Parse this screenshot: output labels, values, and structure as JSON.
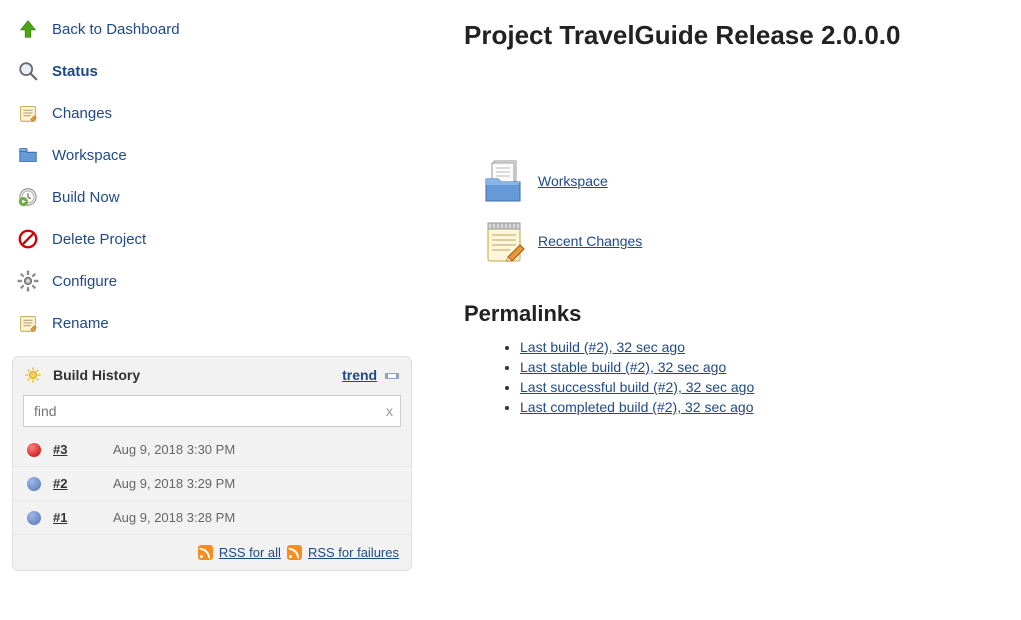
{
  "nav": {
    "back": "Back to Dashboard",
    "status": "Status",
    "changes": "Changes",
    "workspace": "Workspace",
    "build_now": "Build Now",
    "delete_project": "Delete Project",
    "configure": "Configure",
    "rename": "Rename"
  },
  "build_history": {
    "title": "Build History",
    "trend_label": "trend",
    "find_placeholder": "find",
    "builds": [
      {
        "number": "#3",
        "date": "Aug 9, 2018 3:30 PM",
        "status": "red"
      },
      {
        "number": "#2",
        "date": "Aug 9, 2018 3:29 PM",
        "status": "blue"
      },
      {
        "number": "#1",
        "date": "Aug 9, 2018 3:28 PM",
        "status": "blue"
      }
    ],
    "rss_all": "RSS for all",
    "rss_failures": "RSS for failures"
  },
  "main": {
    "title": "Project TravelGuide Release 2.0.0.0",
    "workspace_link": "Workspace",
    "recent_changes_link": "Recent Changes",
    "permalinks_heading": "Permalinks",
    "permalinks": [
      "Last build (#2), 32 sec ago",
      "Last stable build (#2), 32 sec ago",
      "Last successful build (#2), 32 sec ago",
      "Last completed build (#2), 32 sec ago"
    ]
  }
}
